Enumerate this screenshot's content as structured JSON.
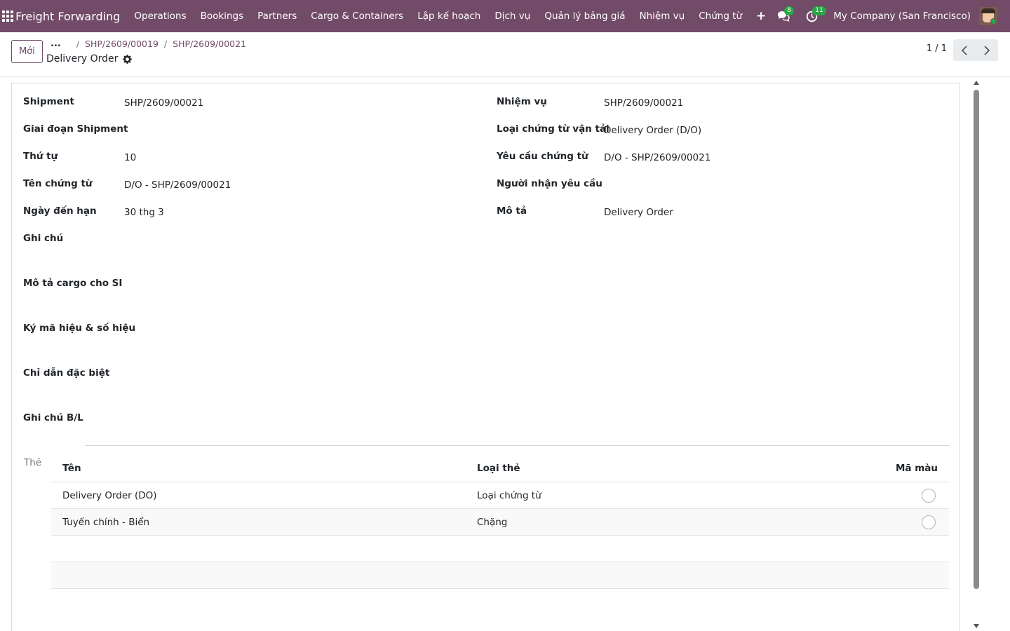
{
  "navbar": {
    "brand": "Freight Forwarding",
    "menu": [
      "Operations",
      "Bookings",
      "Partners",
      "Cargo & Containers",
      "Lập kế hoạch",
      "Dịch vụ",
      "Quản lý bảng giá",
      "Nhiệm vụ",
      "Chứng từ"
    ],
    "plus": "+",
    "messages_count": "8",
    "activities_count": "11",
    "company": "My Company (San Francisco)"
  },
  "control": {
    "new_button": "Mới",
    "breadcrumb": {
      "dots": "...",
      "items": [
        "SHP/2609/00019",
        "SHP/2609/00021"
      ]
    },
    "title": "Delivery Order",
    "pager": "1 / 1"
  },
  "form": {
    "left": [
      {
        "label": "Shipment",
        "value": "SHP/2609/00021"
      },
      {
        "label": "Giai đoạn Shipment",
        "value": ""
      },
      {
        "label": "Thứ tự",
        "value": "10"
      },
      {
        "label": "Tên chứng từ",
        "value": "D/O - SHP/2609/00021"
      },
      {
        "label": "Ngày đến hạn",
        "value": "30 thg 3"
      },
      {
        "label": "Ghi chú",
        "value": ""
      },
      {
        "label": "Mô tả cargo cho SI",
        "value": ""
      },
      {
        "label": "Ký mã hiệu & số hiệu",
        "value": ""
      },
      {
        "label": "Chỉ dẫn đặc biệt",
        "value": ""
      },
      {
        "label": "Ghi chú B/L",
        "value": ""
      }
    ],
    "right": [
      {
        "label": "Nhiệm vụ",
        "value": "SHP/2609/00021"
      },
      {
        "label": "Loại chứng từ vận tải",
        "value": "Delivery Order (D/O)"
      },
      {
        "label": "Yêu cầu chứng từ",
        "value": "D/O - SHP/2609/00021"
      },
      {
        "label": "Người nhận yêu cầu",
        "value": ""
      },
      {
        "label": "Mô tả",
        "value": "Delivery Order"
      }
    ],
    "tags_label": "Thẻ",
    "tags_table": {
      "columns": [
        "Tên",
        "Loại thẻ",
        "Mã màu"
      ],
      "rows": [
        {
          "name": "Delivery Order (DO)",
          "type": "Loại chứng từ"
        },
        {
          "name": "Tuyến chính - Biển",
          "type": "Chặng"
        }
      ]
    }
  },
  "colors": {
    "brand": "#714b67",
    "badge": "#28a745"
  }
}
